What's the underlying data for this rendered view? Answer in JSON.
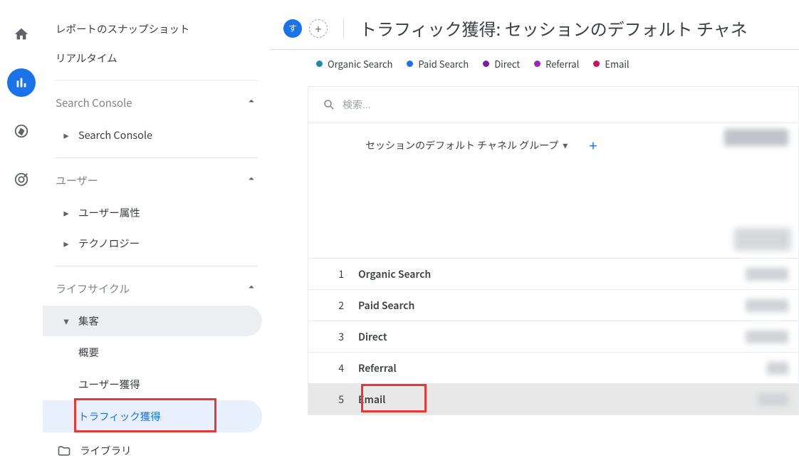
{
  "rail": {
    "home": "home",
    "reports": "reports",
    "explore": "explore",
    "ads": "ads"
  },
  "sidebar": {
    "snapshot": "レポートのスナップショット",
    "realtime": "リアルタイム",
    "search_console_section": "Search Console",
    "search_console_item": "Search Console",
    "users_section": "ユーザー",
    "user_attrs": "ユーザー属性",
    "technology": "テクノロジー",
    "lifecycle_section": "ライフサイクル",
    "acquisition": "集客",
    "overview": "概要",
    "user_acquisition": "ユーザー獲得",
    "traffic_acquisition": "トラフィック獲得",
    "library": "ライブラリ"
  },
  "header": {
    "badge_letter": "す",
    "title": "トラフィック獲得: セッションのデフォルト チャネ"
  },
  "legend": {
    "items": [
      {
        "label": "Organic Search",
        "color": "#1e88a8"
      },
      {
        "label": "Paid Search",
        "color": "#1a73e8"
      },
      {
        "label": "Direct",
        "color": "#7b1fa2"
      },
      {
        "label": "Referral",
        "color": "#9c27b0"
      },
      {
        "label": "Email",
        "color": "#c2185b"
      }
    ]
  },
  "search": {
    "placeholder": "検索..."
  },
  "dimension": {
    "label": "セッションのデフォルト チャネル グループ"
  },
  "rows": [
    {
      "n": "1",
      "label": "Organic Search"
    },
    {
      "n": "2",
      "label": "Paid Search"
    },
    {
      "n": "3",
      "label": "Direct"
    },
    {
      "n": "4",
      "label": "Referral"
    },
    {
      "n": "5",
      "label": "Email"
    }
  ]
}
